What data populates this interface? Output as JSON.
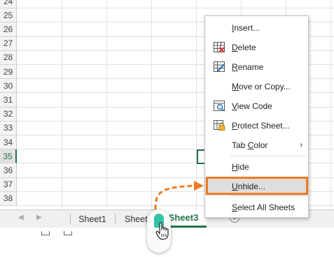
{
  "rows": [
    "24",
    "25",
    "26",
    "27",
    "28",
    "29",
    "30",
    "31",
    "32",
    "33",
    "34",
    "35",
    "36",
    "37",
    "38"
  ],
  "active_row": "35",
  "sheet_tabs": {
    "tab1": "Sheet1",
    "tab2": "Sheet2",
    "active": "Sheet3"
  },
  "context_menu": {
    "items": [
      {
        "label": "Insert...",
        "icon": ""
      },
      {
        "label": "Delete",
        "icon": "delete-sheet-icon"
      },
      {
        "label": "Rename",
        "icon": "rename-icon"
      },
      {
        "label": "Move or Copy...",
        "icon": ""
      },
      {
        "label": "View Code",
        "icon": "view-code-icon"
      },
      {
        "label": "Protect Sheet...",
        "icon": "protect-sheet-icon"
      },
      {
        "label": "Tab Color",
        "icon": "",
        "submenu": true
      },
      {
        "label": "Hide",
        "icon": ""
      },
      {
        "label": "Unhide...",
        "icon": "",
        "highlighted": true
      },
      {
        "label": "Select All Sheets",
        "icon": ""
      }
    ]
  },
  "colors": {
    "excel_green": "#217346",
    "highlight_orange": "#ee7b22",
    "click_indicator": "#33c4a5"
  }
}
